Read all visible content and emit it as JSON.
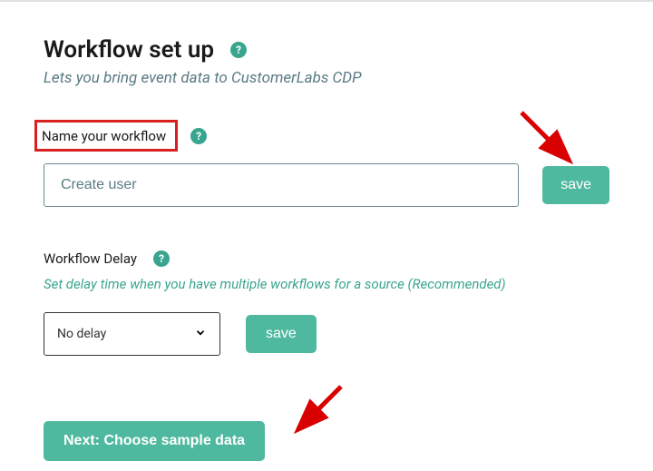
{
  "header": {
    "title": "Workflow set up",
    "subtitle": "Lets you bring event data to CustomerLabs CDP"
  },
  "name_section": {
    "label": "Name your workflow",
    "input_value": "Create user",
    "placeholder": "",
    "save_label": "save"
  },
  "delay_section": {
    "label": "Workflow Delay",
    "hint": "Set delay time when you have multiple workflows for a source (Recommended)",
    "selected": "No delay",
    "save_label": "save"
  },
  "next_button": "Next: Choose sample data",
  "icons": {
    "help": "?"
  }
}
